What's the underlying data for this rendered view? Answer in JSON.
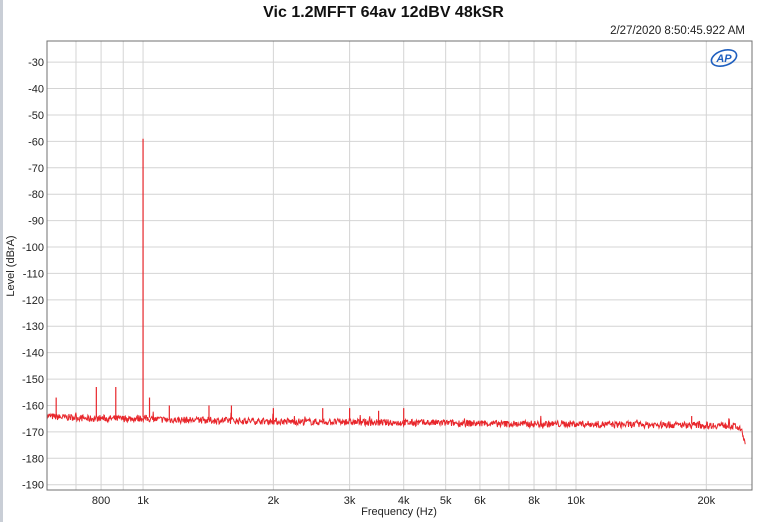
{
  "chart_data": {
    "type": "line",
    "title": "Vic 1.2MFFT 64av 12dBV 48kSR",
    "timestamp": "2/27/2020 8:50:45.922 AM",
    "logo_text": "AP",
    "xlabel": "Frequency (Hz)",
    "ylabel": "Level (dBrA)",
    "x_scale": "log",
    "xlim": [
      600,
      25500
    ],
    "ylim": [
      -192,
      -22
    ],
    "grid": true,
    "x_ticks": [
      {
        "value": 800,
        "label": "800"
      },
      {
        "value": 1000,
        "label": "1k"
      },
      {
        "value": 2000,
        "label": "2k"
      },
      {
        "value": 3000,
        "label": "3k"
      },
      {
        "value": 4000,
        "label": "4k"
      },
      {
        "value": 5000,
        "label": "5k"
      },
      {
        "value": 6000,
        "label": "6k"
      },
      {
        "value": 8000,
        "label": "8k"
      },
      {
        "value": 10000,
        "label": "10k"
      },
      {
        "value": 20000,
        "label": "20k"
      }
    ],
    "x_minor_grid": [
      700,
      900,
      7000,
      9000
    ],
    "y_ticks": [
      {
        "value": -30,
        "label": "-30"
      },
      {
        "value": -40,
        "label": "-40"
      },
      {
        "value": -50,
        "label": "-50"
      },
      {
        "value": -60,
        "label": "-60"
      },
      {
        "value": -70,
        "label": "-70"
      },
      {
        "value": -80,
        "label": "-80"
      },
      {
        "value": -90,
        "label": "-90"
      },
      {
        "value": -100,
        "label": "-100"
      },
      {
        "value": -110,
        "label": "-110"
      },
      {
        "value": -120,
        "label": "-120"
      },
      {
        "value": -130,
        "label": "-130"
      },
      {
        "value": -140,
        "label": "-140"
      },
      {
        "value": -150,
        "label": "-150"
      },
      {
        "value": -160,
        "label": "-160"
      },
      {
        "value": -170,
        "label": "-170"
      },
      {
        "value": -180,
        "label": "-180"
      },
      {
        "value": -190,
        "label": "-190"
      }
    ],
    "series": [
      {
        "color": "#e8262b",
        "x": [
          600,
          650,
          700,
          750,
          800,
          850,
          900,
          950,
          1000,
          1050,
          1100,
          1200,
          1300,
          1400,
          1500,
          1700,
          2000,
          2500,
          3000,
          3500,
          4000,
          5000,
          6000,
          7000,
          8000,
          10000,
          12000,
          15000,
          18000,
          20000,
          22000,
          23500,
          24200,
          24600
        ],
        "y": [
          -164,
          -164.5,
          -164.5,
          -165,
          -164.8,
          -165,
          -165,
          -165,
          -164.8,
          -165.2,
          -165.3,
          -165.5,
          -165.5,
          -165.6,
          -165.7,
          -165.8,
          -166,
          -166.2,
          -166.3,
          -166.5,
          -166.5,
          -166.6,
          -166.8,
          -167,
          -167,
          -167,
          -167.2,
          -167.3,
          -167.4,
          -167.5,
          -167.5,
          -168,
          -170,
          -175
        ]
      }
    ],
    "peaks": [
      {
        "x": 630,
        "y": -157
      },
      {
        "x": 780,
        "y": -153
      },
      {
        "x": 865,
        "y": -153
      },
      {
        "x": 1000,
        "y": -59
      },
      {
        "x": 1035,
        "y": -157
      },
      {
        "x": 1150,
        "y": -160
      },
      {
        "x": 1420,
        "y": -160
      },
      {
        "x": 1600,
        "y": -160
      },
      {
        "x": 2000,
        "y": -161
      },
      {
        "x": 2600,
        "y": -161
      },
      {
        "x": 3000,
        "y": -161
      },
      {
        "x": 3500,
        "y": -162
      },
      {
        "x": 4000,
        "y": -161
      },
      {
        "x": 18500,
        "y": -164
      }
    ]
  }
}
